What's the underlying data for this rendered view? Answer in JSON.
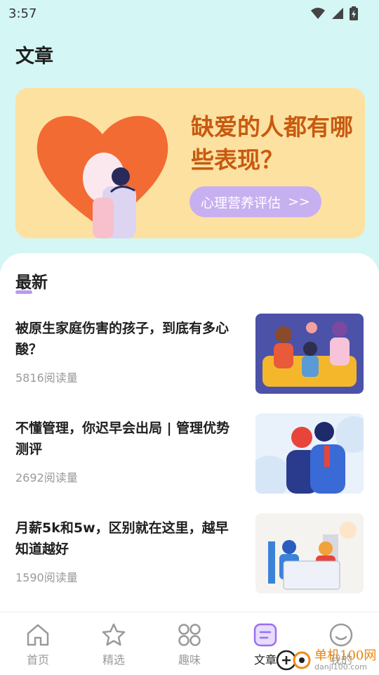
{
  "status_bar": {
    "time": "3:57"
  },
  "page": {
    "title": "文章"
  },
  "banner": {
    "headline": "缺爱的人都有哪些表现？",
    "cta_label": "心理营养评估",
    "cta_arrow": ">>"
  },
  "latest": {
    "section_title": "最新",
    "articles": [
      {
        "title": "被原生家庭伤害的孩子，到底有多心酸？",
        "views": "5816阅读量"
      },
      {
        "title": "不懂管理，你迟早会出局 | 管理优势测评",
        "views": "2692阅读量"
      },
      {
        "title": "月薪5k和5w，区别就在这里，越早知道越好",
        "views": "1590阅读量"
      }
    ]
  },
  "bottom_nav": {
    "items": [
      {
        "label": "首页",
        "icon": "home-icon"
      },
      {
        "label": "精选",
        "icon": "star-icon"
      },
      {
        "label": "趣味",
        "icon": "grid-icon"
      },
      {
        "label": "文章",
        "icon": "article-icon",
        "active": true
      },
      {
        "label": "我的",
        "icon": "profile-icon"
      }
    ]
  },
  "watermark": {
    "text": "单机100网",
    "sub": "danji100.com"
  },
  "colors": {
    "top_background": "#d4f6f5",
    "banner_background": "#fde1a0",
    "headline": "#c75a10",
    "cta": "#c7b0ef",
    "accent": "#b89af0"
  }
}
